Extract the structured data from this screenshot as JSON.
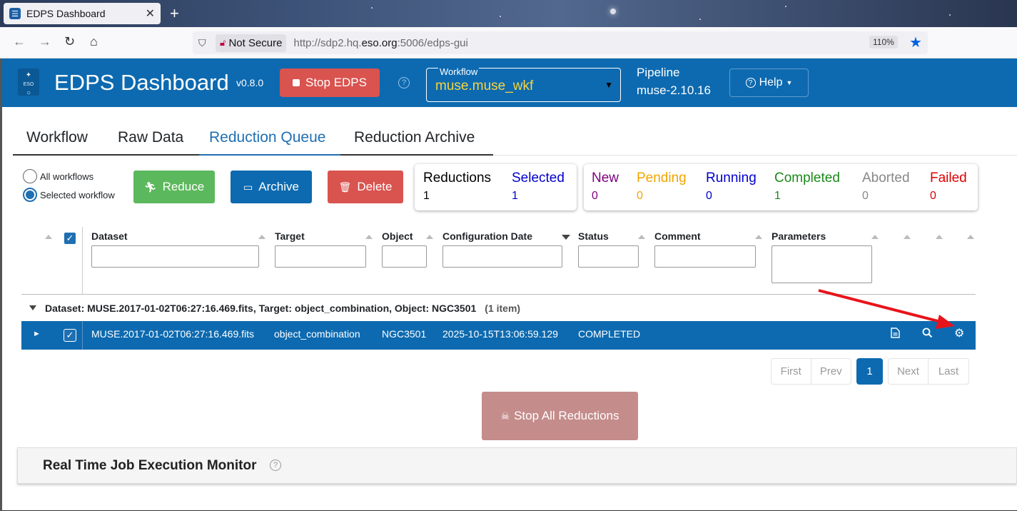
{
  "browser": {
    "tab_title": "EDPS Dashboard",
    "security_label": "Not Secure",
    "url_prefix": "http://sdp2.hq.",
    "url_domain": "eso.org",
    "url_suffix": ":5006/edps-gui",
    "zoom": "110%"
  },
  "header": {
    "title": "EDPS Dashboard",
    "version": "v0.8.0",
    "stop_label": "Stop EDPS",
    "workflow_label": "Workflow",
    "workflow_value": "muse.muse_wkf",
    "pipeline_label": "Pipeline",
    "pipeline_value": "muse-2.10.16",
    "help_label": "Help",
    "logo_text": "ESO"
  },
  "tabs": [
    "Workflow",
    "Raw Data",
    "Reduction Queue",
    "Reduction Archive"
  ],
  "toolbar": {
    "radio_all": "All workflows",
    "radio_selected": "Selected workflow",
    "reduce": "Reduce",
    "archive": "Archive",
    "delete": "Delete"
  },
  "counts": {
    "reductions_label": "Reductions",
    "reductions": "1",
    "selected_label": "Selected",
    "selected": "1",
    "new_label": "New",
    "new": "0",
    "pending_label": "Pending",
    "pending": "0",
    "running_label": "Running",
    "running": "0",
    "completed_label": "Completed",
    "completed": "1",
    "aborted_label": "Aborted",
    "aborted": "0",
    "failed_label": "Failed",
    "failed": "0"
  },
  "colors": {
    "header": "#0d6ab0",
    "new": "#800080",
    "pending": "#f0a500",
    "running": "#0000cc",
    "completed": "#1a8a1a",
    "aborted": "#888888",
    "failed": "#e00000",
    "reduce": "#5cb85c",
    "delete": "#d9534f"
  },
  "table": {
    "columns": [
      "Dataset",
      "Target",
      "Object",
      "Configuration Date",
      "Status",
      "Comment",
      "Parameters"
    ],
    "group_label": "Dataset: MUSE.2017-01-02T06:27:16.469.fits, Target: object_combination, Object: NGC3501",
    "group_count": "(1 item)",
    "row": {
      "dataset": "MUSE.2017-01-02T06:27:16.469.fits",
      "target": "object_combination",
      "object": "NGC3501",
      "config_date": "2025-10-15T13:06:59.129",
      "status": "COMPLETED"
    },
    "row_icons": [
      "document-icon",
      "search-icon",
      "gear-icon"
    ]
  },
  "pager": {
    "first": "First",
    "prev": "Prev",
    "page": "1",
    "next": "Next",
    "last": "Last"
  },
  "stop_all": "Stop All Reductions",
  "monitor_title": "Real Time Job Execution Monitor"
}
